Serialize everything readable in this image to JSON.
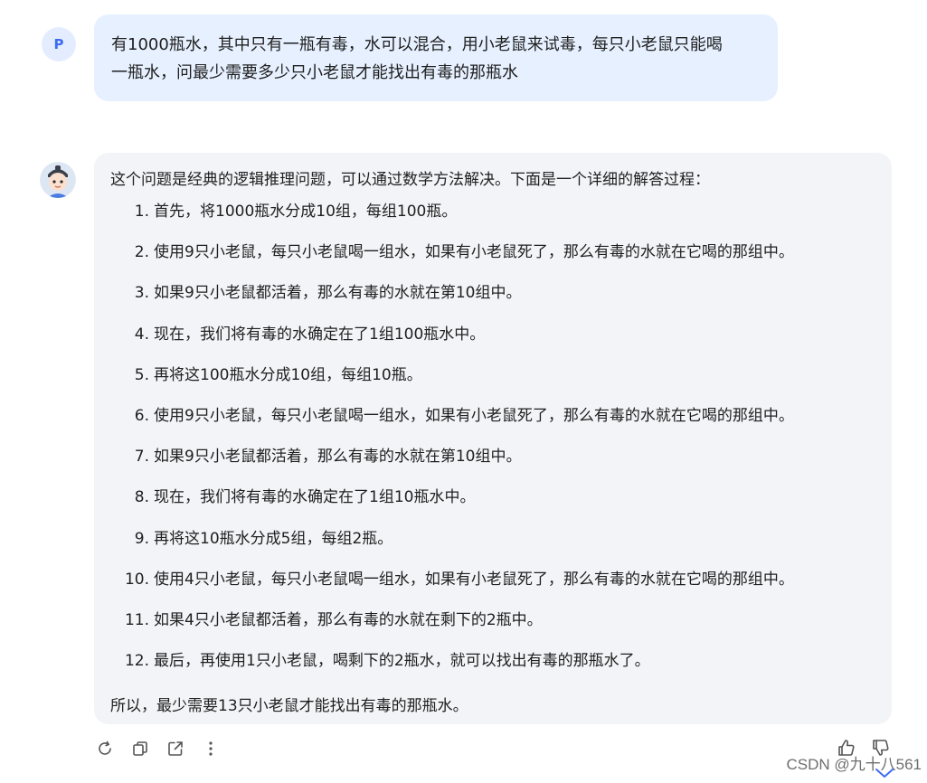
{
  "user_message": {
    "avatar_letter": "P",
    "lines": [
      "有1000瓶水，其中只有一瓶有毒，水可以混合，用小老鼠来试毒，每只小老鼠只能喝",
      "一瓶水，问最少需要多少只小老鼠才能找出有毒的那瓶水"
    ]
  },
  "assistant_message": {
    "intro": "这个问题是经典的逻辑推理问题，可以通过数学方法解决。下面是一个详细的解答过程：",
    "steps": [
      {
        "num": "1.",
        "text": "首先，将1000瓶水分成10组，每组100瓶。"
      },
      {
        "num": "2.",
        "text": "使用9只小老鼠，每只小老鼠喝一组水，如果有小老鼠死了，那么有毒的水就在它喝的那组中。"
      },
      {
        "num": "3.",
        "text": "如果9只小老鼠都活着，那么有毒的水就在第10组中。"
      },
      {
        "num": "4.",
        "text": "现在，我们将有毒的水确定在了1组100瓶水中。"
      },
      {
        "num": "5.",
        "text": "再将这100瓶水分成10组，每组10瓶。"
      },
      {
        "num": "6.",
        "text": "使用9只小老鼠，每只小老鼠喝一组水，如果有小老鼠死了，那么有毒的水就在它喝的那组中。"
      },
      {
        "num": "7.",
        "text": "如果9只小老鼠都活着，那么有毒的水就在第10组中。"
      },
      {
        "num": "8.",
        "text": "现在，我们将有毒的水确定在了1组10瓶水中。"
      },
      {
        "num": "9.",
        "text": "再将这10瓶水分成5组，每组2瓶。"
      },
      {
        "num": "10.",
        "text": "使用4只小老鼠，每只小老鼠喝一组水，如果有小老鼠死了，那么有毒的水就在它喝的那组中。"
      },
      {
        "num": "11.",
        "text": "如果4只小老鼠都活着，那么有毒的水就在剩下的2瓶中。"
      },
      {
        "num": "12.",
        "text": "最后，再使用1只小老鼠，喝剩下的2瓶水，就可以找出有毒的那瓶水了。"
      }
    ],
    "conclusion": "所以，最少需要13只小老鼠才能找出有毒的那瓶水。"
  },
  "toolbar": {
    "icons": [
      "refresh-icon",
      "copy-icon",
      "share-icon",
      "more-icon"
    ]
  },
  "feedback": {
    "icons": [
      "thumbs-up-icon",
      "thumbs-down-icon"
    ]
  },
  "watermark": "CSDN @九十八561",
  "colors": {
    "user_bubble": "#e6f0ff",
    "assistant_bubble": "#f3f4f8",
    "accent": "#3d6cf0",
    "icon": "#555555"
  }
}
